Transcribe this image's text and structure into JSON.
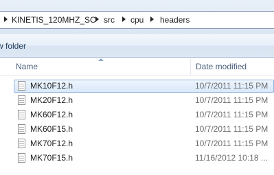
{
  "breadcrumb": {
    "items": [
      "KINETIS_120MHZ_SC",
      "src",
      "cpu",
      "headers"
    ]
  },
  "toolbar": {
    "new_folder_label": "w folder"
  },
  "columns": {
    "name": "Name",
    "date_modified": "Date modified"
  },
  "files": [
    {
      "name": "MK10F12.h",
      "date": "10/7/2011 11:15 PM",
      "selected": true
    },
    {
      "name": "MK20F12.h",
      "date": "10/7/2011 11:15 PM",
      "selected": false
    },
    {
      "name": "MK60F12.h",
      "date": "10/7/2011 11:15 PM",
      "selected": false
    },
    {
      "name": "MK60F15.h",
      "date": "10/7/2011 11:15 PM",
      "selected": false
    },
    {
      "name": "MK70F12.h",
      "date": "10/7/2011 11:15 PM",
      "selected": false
    },
    {
      "name": "MK70F15.h",
      "date": "11/16/2012 10:18 ...",
      "selected": false
    }
  ],
  "icons": {
    "breadcrumb_separator": "chevron-right-icon",
    "sort_indicator": "sort-ascending-icon",
    "file": "header-file-icon"
  },
  "colors": {
    "selection_border": "#8fb2dc",
    "selection_fill": "#d9e8fa",
    "toolbar_text": "#1e3b5a",
    "header_text": "#4c607a"
  }
}
